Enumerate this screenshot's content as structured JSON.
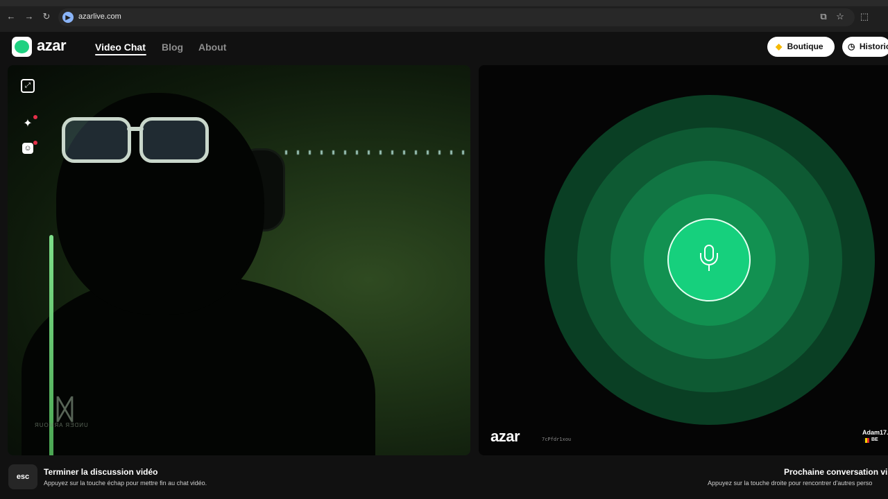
{
  "browser": {
    "url": "azarlive.com",
    "site_icon": "video-camera-icon"
  },
  "header": {
    "logo_text": "azar",
    "nav": [
      {
        "label": "Video Chat",
        "active": true
      },
      {
        "label": "Blog",
        "active": false
      },
      {
        "label": "About",
        "active": false
      }
    ],
    "boutique_label": "Boutique",
    "history_label": "Historic"
  },
  "self_video": {
    "tools": [
      "expand-icon",
      "sparkles-icon",
      "face-sticker-icon"
    ],
    "brand_caption": "UNDER ARMOUR"
  },
  "partner": {
    "watermark_logo": "azar",
    "watermark_id": "7cPfdr1xou",
    "name": "Adam17.",
    "country": "BE",
    "accent": "#16d07d"
  },
  "footer": {
    "esc_key": "esc",
    "end_title": "Terminer la discussion vidéo",
    "end_hint": "Appuyez sur la touche échap pour mettre fin au chat vidéo.",
    "next_title": "Prochaine conversation vi",
    "next_hint": "Appuyez sur la touche droite pour rencontrer d'autres perso"
  }
}
